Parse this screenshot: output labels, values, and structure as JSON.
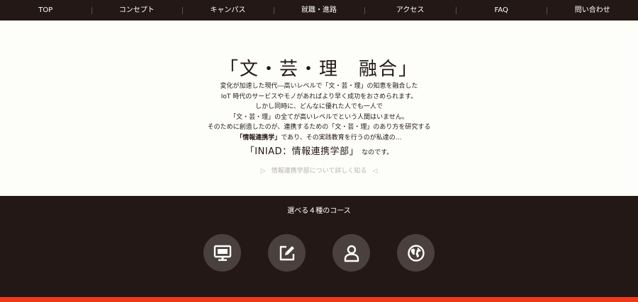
{
  "nav": {
    "items": [
      "TOP",
      "コンセプト",
      "キャンパス",
      "就職・進路",
      "アクセス",
      "FAQ",
      "問い合わせ"
    ]
  },
  "hero": {
    "title": "「文・芸・理　融合」",
    "lines": [
      "変化が加速した現代―高いレベルで「文・芸・理」の知恵を融合した",
      "IoT 時代のサービスやモノがあればより早く成功をおさめられます。",
      "しかし同時に、どんなに優れた人でも一人で",
      "「文・芸・理」の全てが高いレベルでという人間はいません。",
      "そのために創造したのが、連携するための「文・芸・理」のあり方を研究する"
    ],
    "last_line_bold": "「情報連携学」",
    "last_line_rest": "であり、その実践教育を行うのが私達の…",
    "tagline_big": "「INIAD：情報連携学部」",
    "tagline_small": "なのです。",
    "link_left_arrow": "▷",
    "link_text": "情報連携学部について詳しく知る",
    "link_right_arrow": "◁"
  },
  "courses": {
    "title": "選べる４種のコース",
    "icons": [
      "monitor-icon",
      "edit-icon",
      "person-icon",
      "globe-icon"
    ]
  },
  "colors": {
    "dark": "#231815",
    "hero_bg": "#fdfdfa",
    "circle": "#4a403d",
    "accent": "#ee3a1c"
  }
}
